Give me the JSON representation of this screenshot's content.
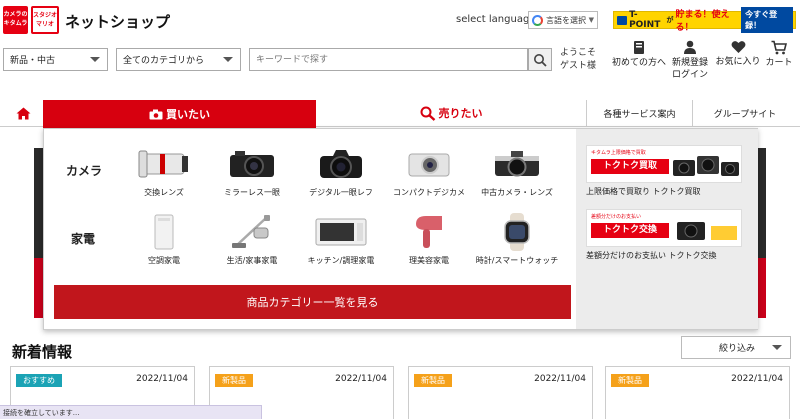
{
  "header": {
    "logo_kitamura": "カメラの キタムラ",
    "logo_studio": "スタジオ マリオ",
    "shop_title": "ネットショップ",
    "select_language": "select language",
    "translate_label": "言語を選択",
    "tpoint": {
      "label": "T-POINT",
      "ga": "が",
      "slogan": "貯まる！使える！",
      "register": "今すぐ登録！"
    }
  },
  "search": {
    "condition": "新品・中古",
    "category": "全てのカテゴリから",
    "placeholder": "キーワードで探す",
    "welcome_line1": "ようこそ",
    "welcome_line2": "ゲスト様"
  },
  "header_icons": {
    "first_time": "初めての方へ",
    "register_line1": "新規登録",
    "register_line2": "ログイン",
    "favorites": "お気に入り",
    "cart": "カート"
  },
  "nav": {
    "buy": "買いたい",
    "sell": "売りたい",
    "services": "各種サービス案内",
    "group": "グループサイト"
  },
  "mega_menu": {
    "camera_label": "カメラ",
    "appliance_label": "家電",
    "camera_items": [
      "交換レンズ",
      "ミラーレス一眼",
      "デジタル一眼レフ",
      "コンパクトデジカメ",
      "中古カメラ・レンズ"
    ],
    "appliance_items": [
      "空調家電",
      "生活/家事家電",
      "キッチン/調理家電",
      "理美容家電",
      "時計/スマートウォッチ"
    ],
    "all_categories_button": "商品カテゴリー一覧を見る",
    "promo1": {
      "sub": "キタムラ上限価格で買取",
      "title": "トクトク買取",
      "text": "上限価格で買取り トクトク買取"
    },
    "promo2": {
      "sub": "差額分だけのお支払い",
      "title": "トクトク交換",
      "text": "差額分だけのお支払い トクトク交換"
    }
  },
  "news": {
    "title": "新着情報",
    "filter": "絞り込み",
    "cards": [
      {
        "badge": "おすすめ",
        "badge_color": "#1ba3b5",
        "date": "2022/11/04"
      },
      {
        "badge": "新製品",
        "badge_color": "#f5a11a",
        "date": "2022/11/04"
      },
      {
        "badge": "新製品",
        "badge_color": "#f5a11a",
        "date": "2022/11/04"
      },
      {
        "badge": "新製品",
        "badge_color": "#f5a11a",
        "date": "2022/11/04"
      }
    ]
  },
  "status_bar": "接続を確立しています...",
  "colors": {
    "brand_red": "#d7000f",
    "tpoint_yellow": "#ffd400"
  }
}
